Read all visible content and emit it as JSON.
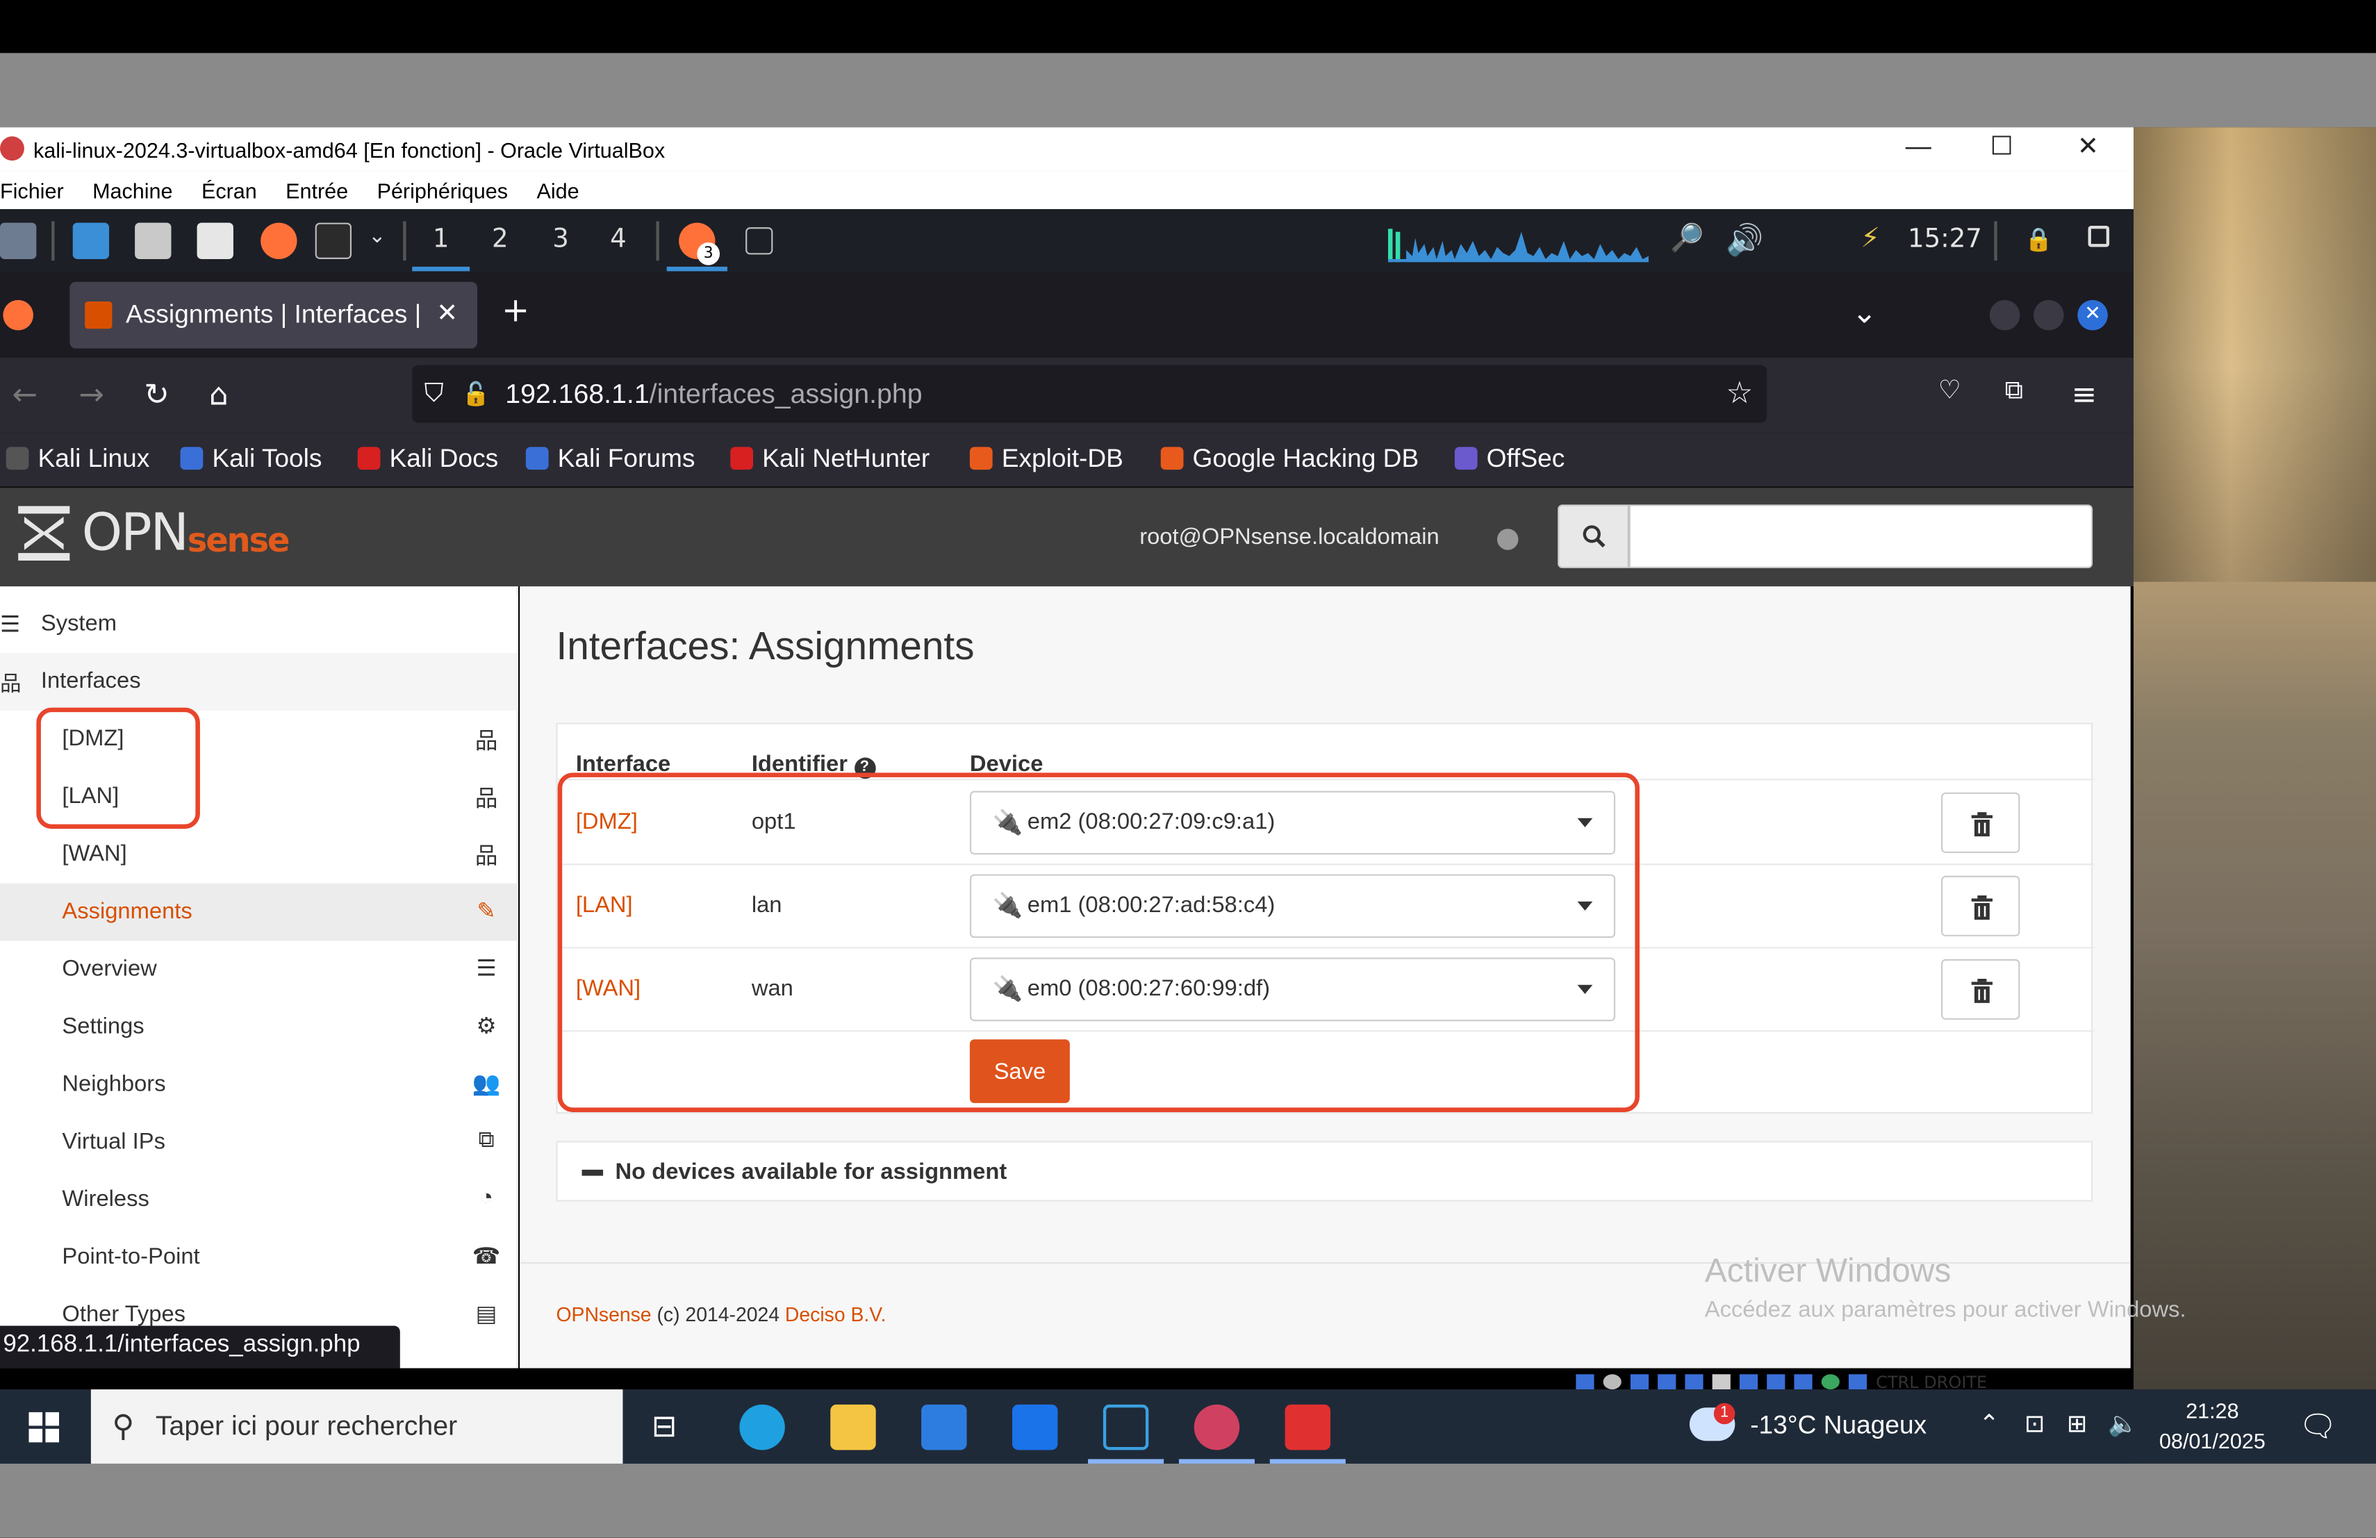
{
  "vbox": {
    "title": "kali-linux-2024.3-virtualbox-amd64 [En fonction] - Oracle VirtualBox",
    "menu": [
      "Fichier",
      "Machine",
      "Écran",
      "Entrée",
      "Périphériques",
      "Aide"
    ],
    "minimize": "—",
    "maximize": "☐",
    "close": "✕"
  },
  "kali_panel": {
    "workspaces": [
      "1",
      "2",
      "3",
      "4"
    ],
    "active_workspace": "1",
    "badge": "3",
    "time": "15:27"
  },
  "browser": {
    "tab_title": "Assignments | Interfaces |",
    "tab_close": "✕",
    "new_tab": "+",
    "url_host": "192.168.1.1",
    "url_path": "/interfaces_assign.php",
    "bookmarks": [
      "Kali Linux",
      "Kali Tools",
      "Kali Docs",
      "Kali Forums",
      "Kali NetHunter",
      "Exploit-DB",
      "Google Hacking DB",
      "OffSec"
    ],
    "status_url": "92.168.1.1/interfaces_assign.php"
  },
  "opnsense": {
    "logo_part1": "OPN",
    "logo_part2": "sense",
    "user": "root@OPNsense.localdomain",
    "search_placeholder": ""
  },
  "sidebar": {
    "system": "System",
    "interfaces": "Interfaces",
    "items": [
      {
        "label": "[DMZ]",
        "icon": "sitemap-icon"
      },
      {
        "label": "[LAN]",
        "icon": "sitemap-icon"
      },
      {
        "label": "[WAN]",
        "icon": "sitemap-icon"
      },
      {
        "label": "Assignments",
        "icon": "pencil-icon"
      },
      {
        "label": "Overview",
        "icon": "list-icon"
      },
      {
        "label": "Settings",
        "icon": "cogs-icon"
      },
      {
        "label": "Neighbors",
        "icon": "users-icon"
      },
      {
        "label": "Virtual IPs",
        "icon": "copy-icon"
      },
      {
        "label": "Wireless",
        "icon": "wifi-icon"
      },
      {
        "label": "Point-to-Point",
        "icon": "phone-icon"
      },
      {
        "label": "Other Types",
        "icon": "archive-icon"
      }
    ]
  },
  "page": {
    "title": "Interfaces: Assignments",
    "headers": {
      "interface": "Interface",
      "identifier": "Identifier",
      "device": "Device"
    },
    "rows": [
      {
        "interface": "[DMZ]",
        "identifier": "opt1",
        "device": "em2 (08:00:27:09:c9:a1)"
      },
      {
        "interface": "[LAN]",
        "identifier": "lan",
        "device": "em1 (08:00:27:ad:58:c4)"
      },
      {
        "interface": "[WAN]",
        "identifier": "wan",
        "device": "em0 (08:00:27:60:99:df)"
      }
    ],
    "save_label": "Save",
    "no_devices": "No devices available for assignment",
    "footer_brand": "OPNsense",
    "footer_mid": " (c) 2014-2024 ",
    "footer_company": "Deciso B.V."
  },
  "windows": {
    "activate_title": "Activer Windows",
    "activate_sub": "Accédez aux paramètres pour activer Windows.",
    "search_placeholder": "Taper ici pour rechercher",
    "weather": "-13°C  Nuageux",
    "weather_badge": "1",
    "time": "21:28",
    "date": "08/01/2025",
    "vb_hostkey": "CTRL DROITE"
  },
  "colors": {
    "accent": "#d94f00",
    "save": "#e0531c",
    "highlight": "#e8452c"
  }
}
